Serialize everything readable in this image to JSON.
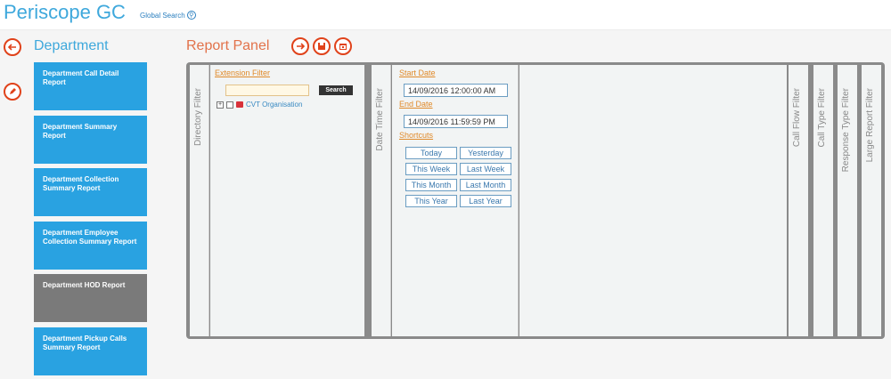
{
  "header": {
    "app_title": "Periscope GC",
    "global_search_label": "Global Search"
  },
  "sidebar": {
    "section_title": "Department",
    "items": [
      {
        "label": "Department Call Detail Report",
        "active": false
      },
      {
        "label": "Department Summary Report",
        "active": false
      },
      {
        "label": "Department Collection Summary Report",
        "active": false
      },
      {
        "label": "Department Employee Collection Summary Report",
        "active": false
      },
      {
        "label": "Department HOD Report",
        "active": true
      },
      {
        "label": "Department Pickup Calls Summary Report",
        "active": false
      }
    ]
  },
  "report_panel": {
    "title": "Report Panel",
    "filters": {
      "directory": "Directory Filter",
      "datetime": "Date Time Filter",
      "call_flow": "Call Flow Filter",
      "call_type": "Call Type Filter",
      "response_type": "Response Type Filter",
      "large_report": "Large Report Filter"
    },
    "extension_filter": {
      "heading": "Extension Filter",
      "search_value": "",
      "search_button": "Search",
      "tree_root": "CVT Organisation"
    },
    "date_filter": {
      "start_label": "Start Date",
      "start_value": "14/09/2016 12:00:00 AM",
      "end_label": "End Date",
      "end_value": "14/09/2016 11:59:59 PM",
      "shortcuts_label": "Shortcuts",
      "shortcuts": [
        "Today",
        "Yesterday",
        "This Week",
        "Last Week",
        "This Month",
        "Last Month",
        "This Year",
        "Last Year"
      ]
    }
  },
  "colors": {
    "brand_blue": "#29a2e1",
    "accent_orange": "#e0421a",
    "active_tile": "#7a7a7a"
  }
}
